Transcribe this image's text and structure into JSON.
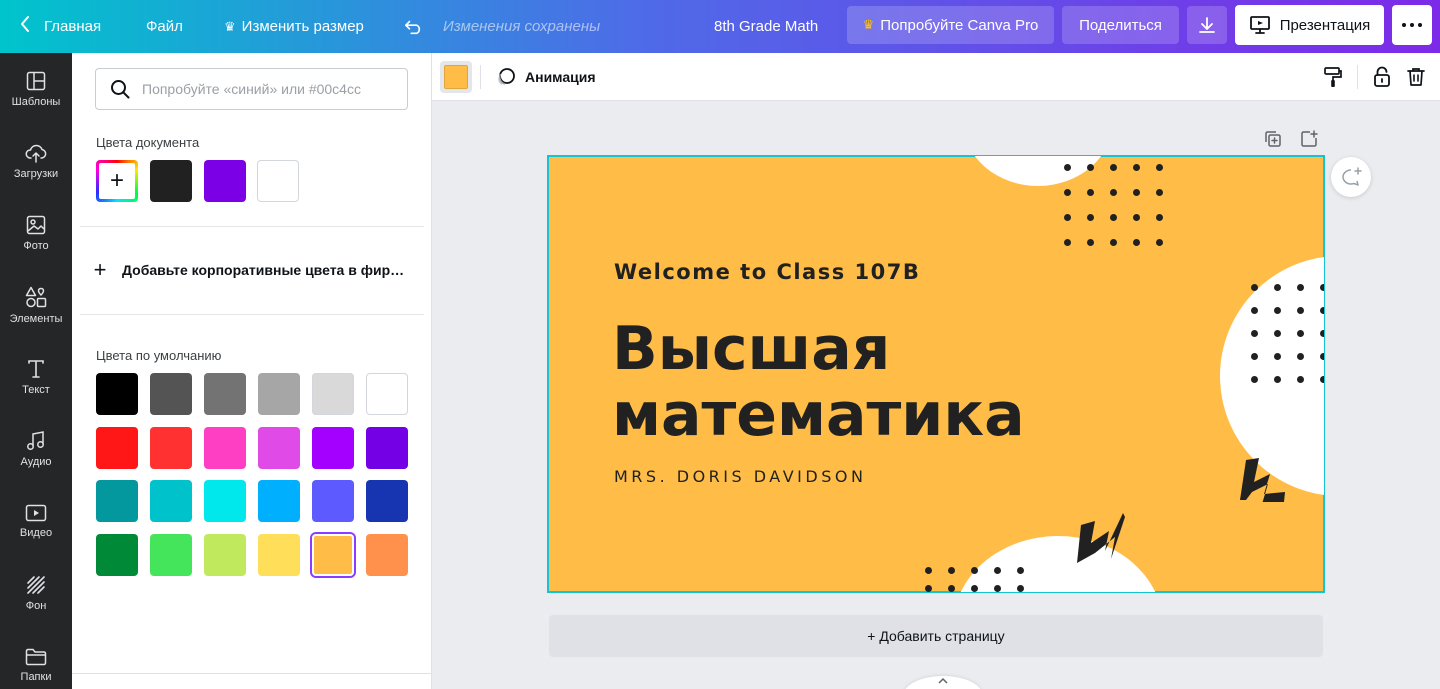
{
  "topbar": {
    "home": "Главная",
    "file": "Файл",
    "resize": "Изменить размер",
    "saved_status": "Изменения сохранены",
    "doc_title": "8th Grade Math",
    "try_pro": "Попробуйте Canva Pro",
    "share": "Поделиться",
    "present": "Презентация"
  },
  "rail": {
    "items": [
      {
        "label": "Шаблоны",
        "icon": "templates-icon"
      },
      {
        "label": "Загрузки",
        "icon": "upload-icon"
      },
      {
        "label": "Фото",
        "icon": "photo-icon"
      },
      {
        "label": "Элементы",
        "icon": "elements-icon"
      },
      {
        "label": "Текст",
        "icon": "text-icon"
      },
      {
        "label": "Аудио",
        "icon": "audio-icon"
      },
      {
        "label": "Видео",
        "icon": "video-icon"
      },
      {
        "label": "Фон",
        "icon": "background-icon"
      },
      {
        "label": "Папки",
        "icon": "folder-icon"
      }
    ]
  },
  "panel": {
    "search_placeholder": "Попробуйте «синий» или #00c4cc",
    "doc_colors_title": "Цвета документа",
    "doc_colors": [
      "#212121",
      "#7c00e6",
      "#ffffff"
    ],
    "brand_colors_label": "Добавьте корпоративные цвета в фир…",
    "default_colors_title": "Цвета по умолчанию",
    "default_colors": [
      [
        "#000000",
        "#545454",
        "#737373",
        "#a6a6a6",
        "#d9d9d9",
        "#ffffff"
      ],
      [
        "#ff1616",
        "#ff3131",
        "#ff3fc3",
        "#e04be8",
        "#a400ff",
        "#7400e6"
      ],
      [
        "#03989e",
        "#00c2cb",
        "#00e8eb",
        "#00b0ff",
        "#5d5bff",
        "#1735b0"
      ],
      [
        "#008a37",
        "#44e55b",
        "#c1e95e",
        "#ffde59",
        "#ffbd47",
        "#ff914d"
      ]
    ],
    "selected_color": "#ffbd47"
  },
  "toolbar": {
    "current_color": "#ffbd47",
    "animation": "Анимация"
  },
  "slide": {
    "background": "#ffbd47",
    "welcome": "Welcome to Class 107B",
    "title_line1": "Высшая",
    "title_line2": "математика",
    "teacher": "MRS. DORIS DAVIDSON"
  },
  "workspace": {
    "add_page": "+ Добавить страницу"
  }
}
